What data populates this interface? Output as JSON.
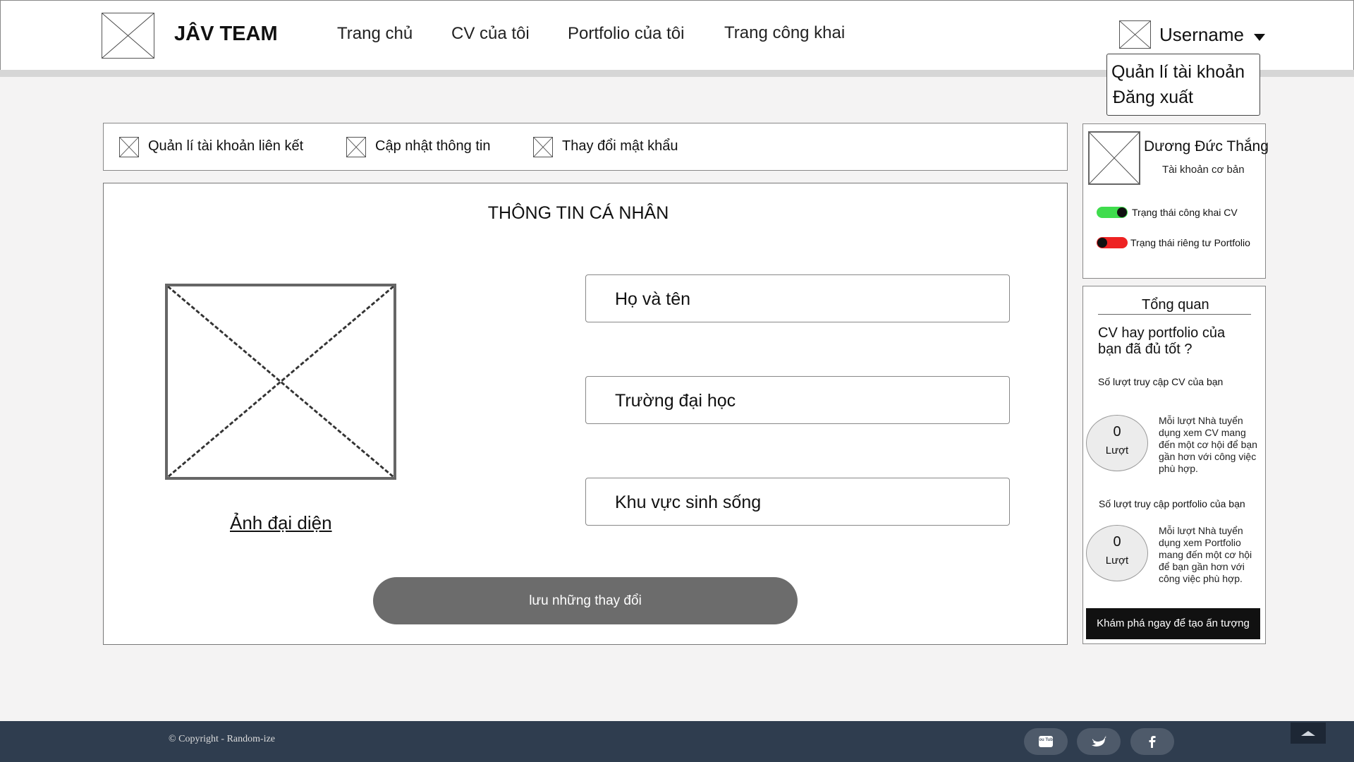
{
  "header": {
    "brand": "JÂV TEAM",
    "nav": [
      "Trang chủ",
      "CV của tôi",
      "Portfolio của tôi",
      "Trang công khai"
    ],
    "username": "Username",
    "dropdown": [
      "Quản lí tài khoản",
      "Đăng xuất"
    ]
  },
  "tabs": [
    "Quản lí tài khoản liên kết",
    "Cập nhật thông tin",
    "Thay đổi mật khẩu"
  ],
  "main": {
    "title": "THÔNG TIN CÁ NHÂN",
    "avatar_link": "Ảnh đại diện",
    "fields": [
      "Họ và tên",
      "Trường đại học",
      "Khu vực sinh sống"
    ],
    "save_button": "lưu những thay đổi"
  },
  "profile": {
    "name": "Dương Đức Thắng",
    "account_type": "Tài khoản cơ bản",
    "toggles": [
      {
        "label": "Trạng thái công khai CV",
        "on": true,
        "color": "#3fdc4d"
      },
      {
        "label": "Trạng thái riêng tư Portfolio",
        "on": false,
        "color": "#ee2222"
      }
    ]
  },
  "overview": {
    "title": "Tổng quan",
    "question": "CV hay portfolio của bạn đã đủ tốt ?",
    "cv_label": "Số lượt truy cập CV của bạn",
    "cv_count": "0",
    "cv_unit": "Lượt",
    "cv_desc": "Mỗi lượt Nhà tuyển dụng xem CV mang đến một cơ hội để bạn gần hơn với công việc phù hợp.",
    "pf_label": "Số lượt truy cập portfolio của bạn",
    "pf_count": "0",
    "pf_unit": "Lượt",
    "pf_desc": "Mỗi lượt Nhà tuyển dụng xem Portfolio mang đến một cơ hội để bạn gần hơn với công việc phù hợp.",
    "cta": "Khám phá ngay để tạo ấn tượng"
  },
  "footer": {
    "copyright": "© Copyright - Random-ize",
    "social_icons": [
      "youtube-icon",
      "twitter-icon",
      "facebook-icon"
    ],
    "youtube_text": "You Tube"
  }
}
